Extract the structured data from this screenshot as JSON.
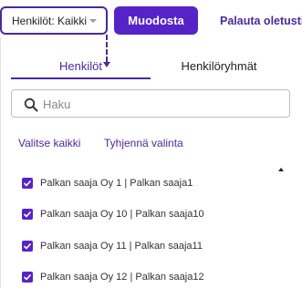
{
  "toolbar": {
    "filter_label": "Henkilöt: Kaikki",
    "primary_label": "Muodosta",
    "reset_label": "Palauta oletusti"
  },
  "tabs": [
    {
      "label": "Henkilöt",
      "active": true
    },
    {
      "label": "Henkilöryhmät",
      "active": false
    }
  ],
  "search": {
    "placeholder": "Haku",
    "value": ""
  },
  "actions": {
    "select_all": "Valitse kaikki",
    "clear": "Tyhjennä valinta"
  },
  "items": [
    {
      "label": "Palkan saaja Oy 1 | Palkan saaja1",
      "checked": true
    },
    {
      "label": "Palkan saaja Oy 10 | Palkan saaja10",
      "checked": true
    },
    {
      "label": "Palkan saaja Oy 11 | Palkan saaja11",
      "checked": true
    },
    {
      "label": "Palkan saaja Oy 12 | Palkan saaja12",
      "checked": true
    }
  ],
  "colors": {
    "accent": "#5624c6",
    "accent_dark": "#4a2a9a"
  },
  "icons": {
    "search": "search-icon",
    "dropdown": "chevron-down-icon",
    "checkbox": "check-icon",
    "scroll": "scroll-up-arrow-icon"
  }
}
